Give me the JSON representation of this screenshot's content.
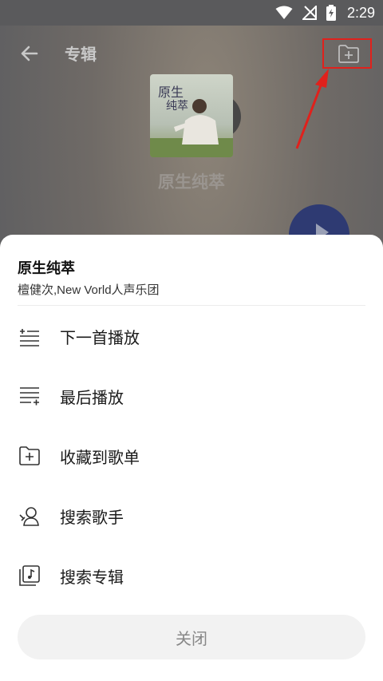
{
  "status_bar": {
    "time": "2:29"
  },
  "header": {
    "title": "专辑"
  },
  "album": {
    "name": "原生纯萃",
    "cover_text": "原生纯萃"
  },
  "sheet": {
    "title": "原生纯萃",
    "subtitle": "檀健次,New Vorld人声乐团",
    "menu": [
      {
        "label": "下一首播放",
        "icon": "play-next-icon"
      },
      {
        "label": "最后播放",
        "icon": "play-last-icon"
      },
      {
        "label": "收藏到歌单",
        "icon": "add-to-playlist-icon"
      },
      {
        "label": "搜索歌手",
        "icon": "search-singer-icon"
      },
      {
        "label": "搜索专辑",
        "icon": "search-album-icon"
      }
    ],
    "close_label": "关闭"
  },
  "colors": {
    "highlight_red": "#e0211c",
    "fab_blue": "#2e3a72",
    "sheet_bg": "#ffffff"
  }
}
